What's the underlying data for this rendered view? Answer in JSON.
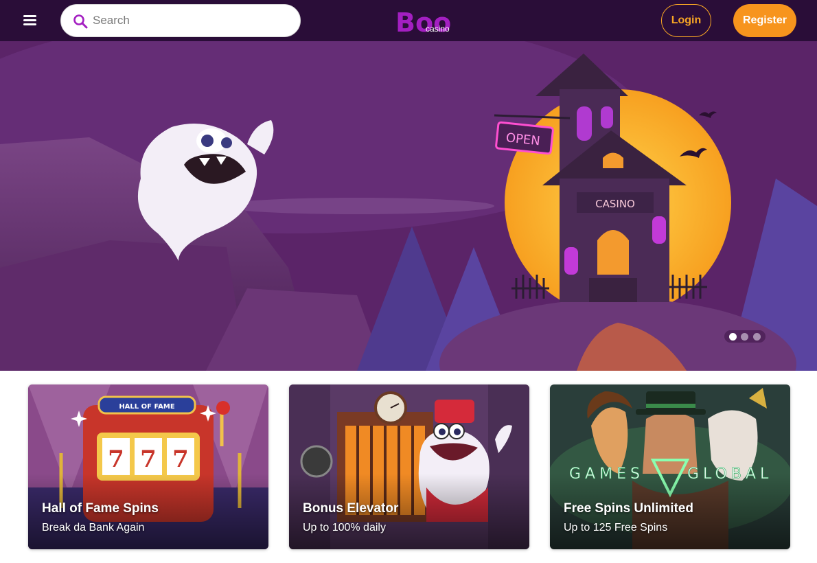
{
  "header": {
    "search_placeholder": "Search",
    "logo_main": "Boo",
    "logo_sub": "casino",
    "login_label": "Login",
    "register_label": "Register"
  },
  "hero": {
    "sign_open": "OPEN",
    "sign_casino": "CASINO",
    "slides": 3,
    "active_slide": 1
  },
  "promos": [
    {
      "title": "Hall of Fame Spins",
      "subtitle": "Break da Bank Again",
      "art_text": "HALL OF FAME",
      "reels": [
        "7",
        "7",
        "7"
      ]
    },
    {
      "title": "Bonus Elevator",
      "subtitle": "Up to 100% daily"
    },
    {
      "title": "Free Spins Unlimited",
      "subtitle": "Up to 125 Free Spins",
      "art_text_left": "GAMES",
      "art_text_right": "GLOBAL"
    }
  ],
  "colors": {
    "header_bg": "#2a0d38",
    "accent_orange": "#f7941d",
    "brand_purple": "#a31fc1"
  }
}
